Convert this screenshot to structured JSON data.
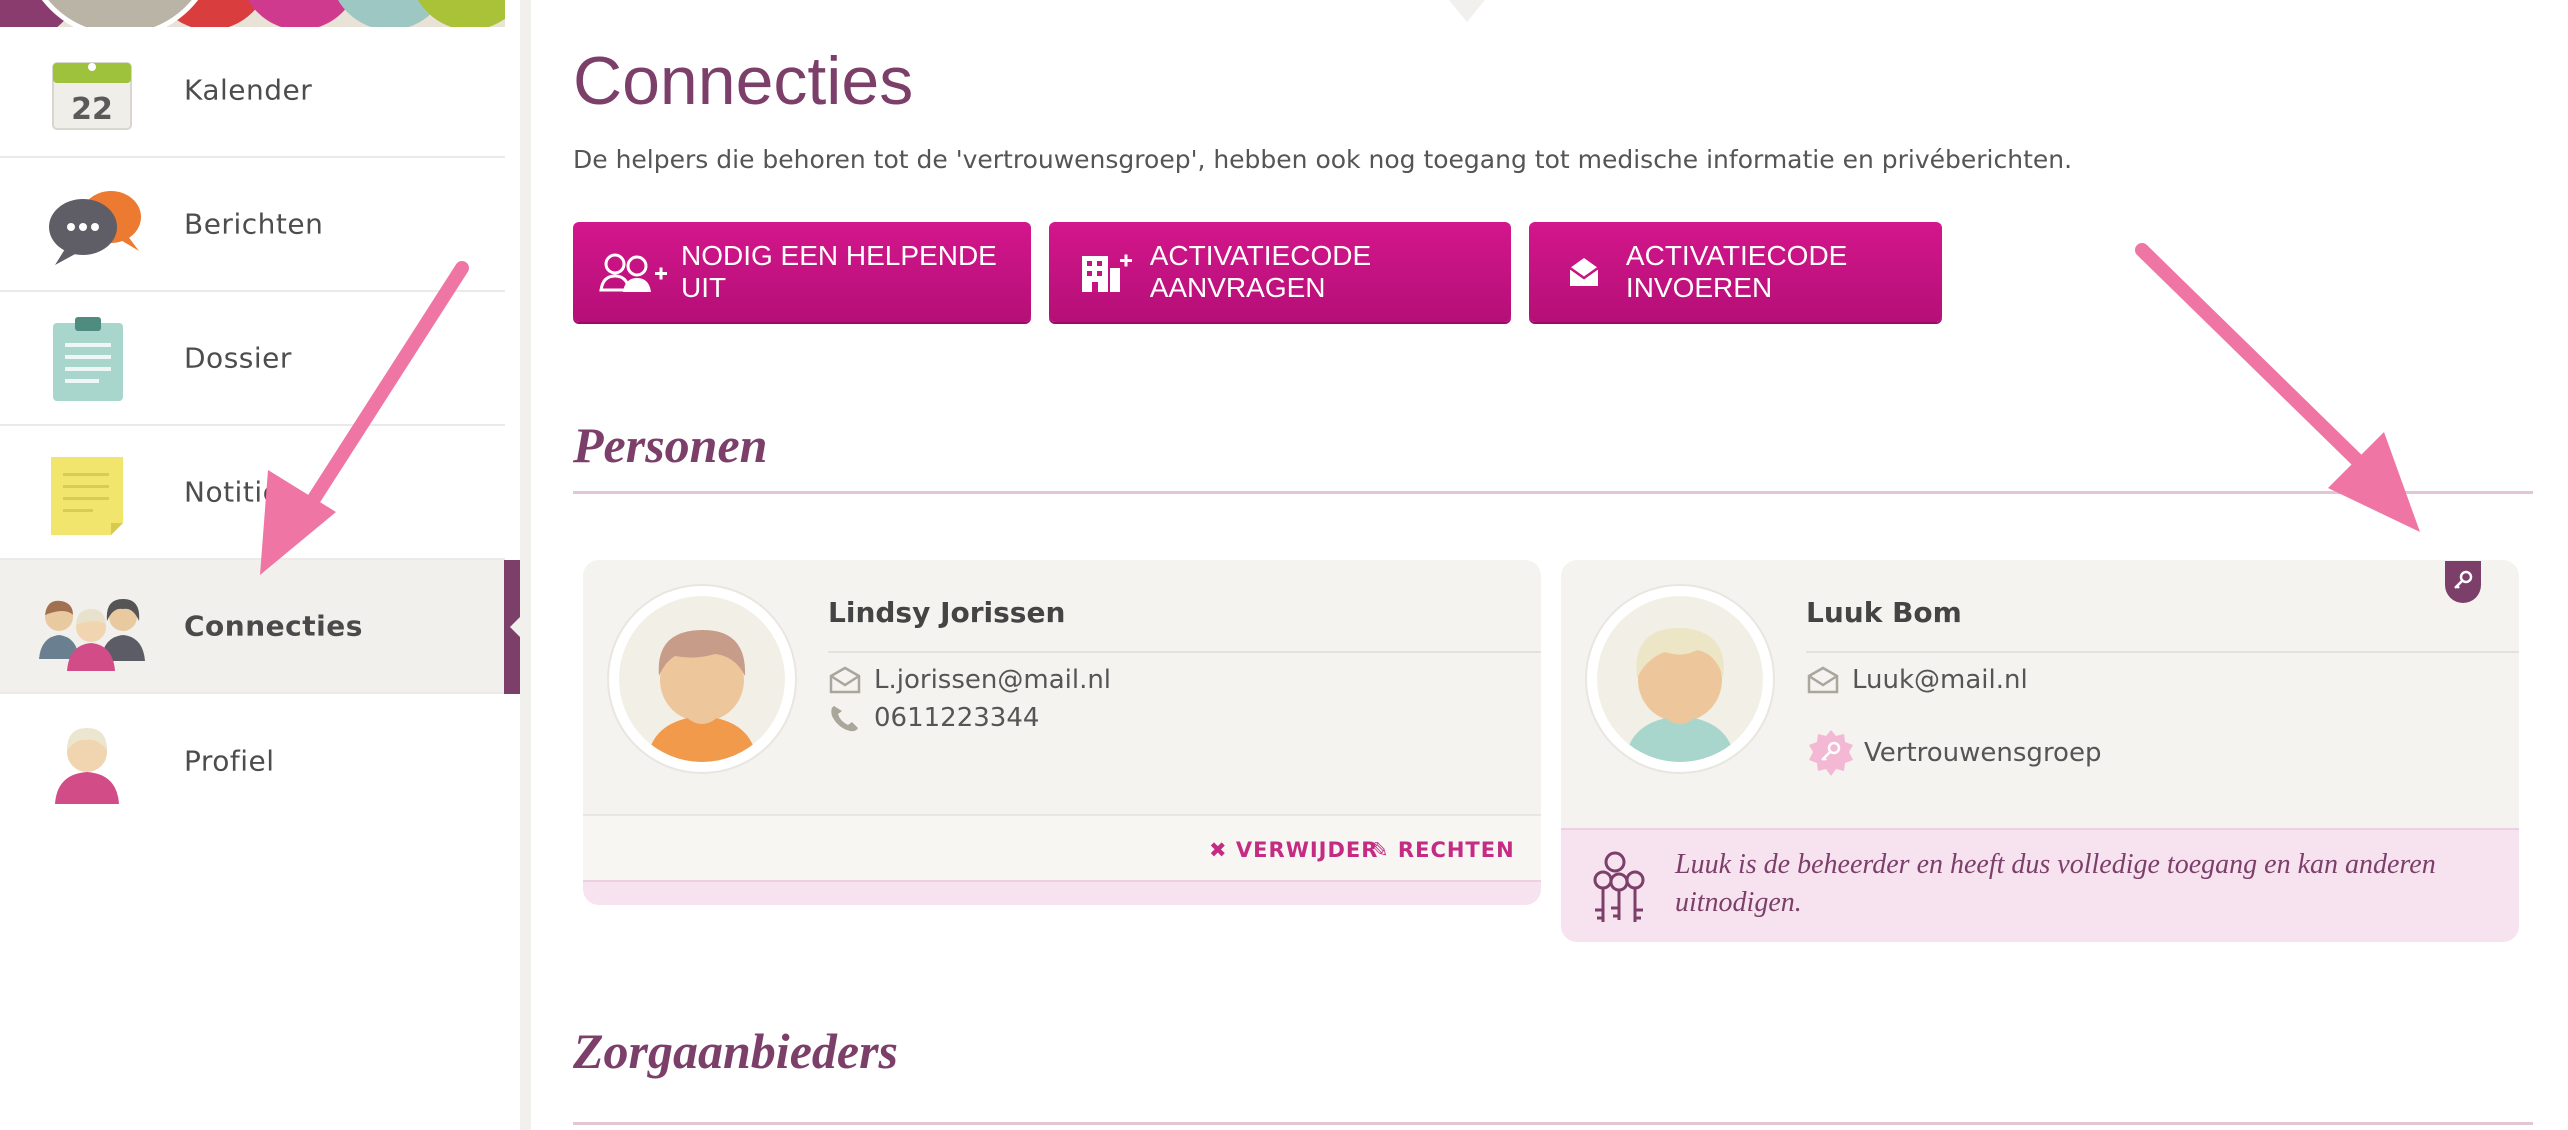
{
  "sidebar": {
    "items": [
      {
        "label": "Kalender",
        "icon": "calendar-icon",
        "calendar_day": "22"
      },
      {
        "label": "Berichten",
        "icon": "chat-bubbles-icon"
      },
      {
        "label": "Dossier",
        "icon": "clipboard-icon"
      },
      {
        "label": "Notities",
        "icon": "sticky-note-icon"
      },
      {
        "label": "Connecties",
        "icon": "people-group-icon",
        "active": true
      },
      {
        "label": "Profiel",
        "icon": "user-avatar-icon"
      }
    ]
  },
  "main": {
    "title": "Connecties",
    "subtitle": "De helpers die behoren tot de 'vertrouwensgroep', hebben ook nog toegang tot medische informatie en privéberichten.",
    "buttons": {
      "invite": "NODIG EEN HELPENDE UIT",
      "request_code": "ACTIVATIECODE AANVRAGEN",
      "enter_code": "ACTIVATIECODE INVOEREN"
    },
    "sections": {
      "persons": "Personen",
      "providers": "Zorgaanbieders"
    },
    "persons": [
      {
        "name": "Lindsy Jorissen",
        "email": "L.jorissen@mail.nl",
        "phone": "0611223344",
        "actions": {
          "remove": "VERWIJDER",
          "rights": "RECHTEN"
        }
      },
      {
        "name": "Luuk Bom",
        "email": "Luuk@mail.nl",
        "group": "Vertrouwensgroep",
        "note": "Luuk is de beheerder en heeft dus volledige toegang en kan anderen uitnodigen."
      }
    ]
  },
  "colors": {
    "brand_purple": "#7c3f6a",
    "button_magenta": "#c8127f",
    "annotation_arrow": "#ef75a4"
  }
}
